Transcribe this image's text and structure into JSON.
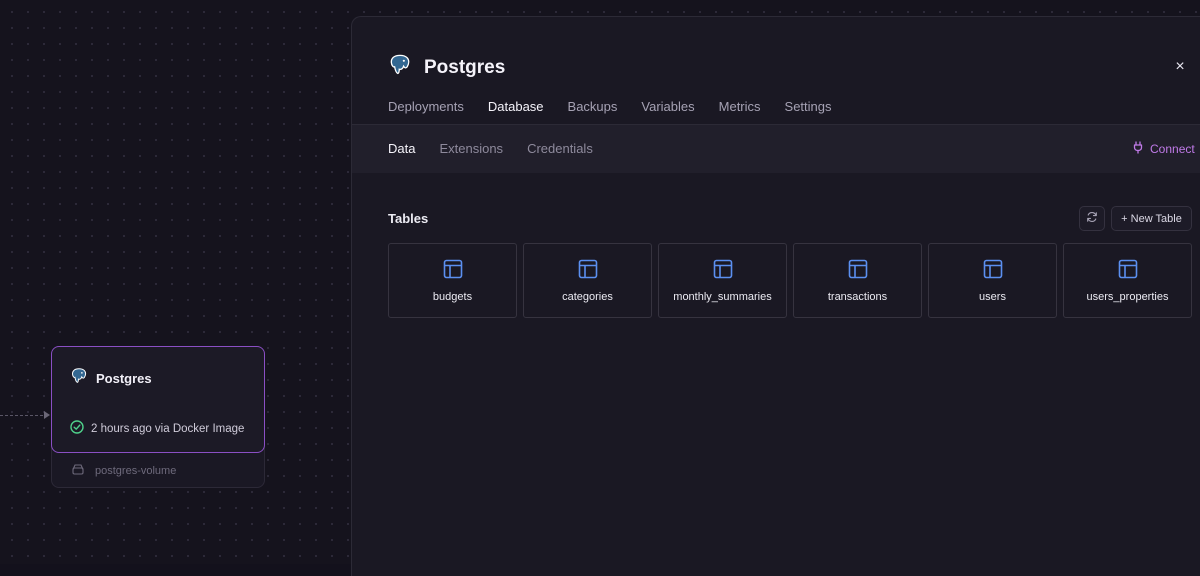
{
  "colors": {
    "accent": "#c07ae8",
    "selected_border": "#8a4fc4",
    "table_icon": "#5b8ff0",
    "status_ok": "#4fd18b"
  },
  "canvas": {
    "service_card": {
      "icon": "postgres-elephant-icon",
      "title": "Postgres",
      "status_icon": "check-circle-icon",
      "status_text": "2 hours ago via Docker Image"
    },
    "volume": {
      "icon": "hard-drive-icon",
      "name": "postgres-volume"
    }
  },
  "panel": {
    "icon": "postgres-elephant-icon",
    "title": "Postgres",
    "close_label": "×",
    "tabs": [
      {
        "label": "Deployments",
        "active": false
      },
      {
        "label": "Database",
        "active": true
      },
      {
        "label": "Backups",
        "active": false
      },
      {
        "label": "Variables",
        "active": false
      },
      {
        "label": "Metrics",
        "active": false
      },
      {
        "label": "Settings",
        "active": false
      }
    ],
    "subtabs": [
      {
        "label": "Data",
        "active": true
      },
      {
        "label": "Extensions",
        "active": false
      },
      {
        "label": "Credentials",
        "active": false
      }
    ],
    "connect": {
      "icon": "plug-icon",
      "label": "Connect"
    },
    "tables_section": {
      "label": "Tables",
      "refresh_icon": "refresh-icon",
      "new_table_label": "+ New Table",
      "tables": [
        {
          "name": "budgets",
          "icon": "table-icon"
        },
        {
          "name": "categories",
          "icon": "table-icon"
        },
        {
          "name": "monthly_summaries",
          "icon": "table-icon"
        },
        {
          "name": "transactions",
          "icon": "table-icon"
        },
        {
          "name": "users",
          "icon": "table-icon"
        },
        {
          "name": "users_properties",
          "icon": "table-icon"
        }
      ]
    }
  }
}
